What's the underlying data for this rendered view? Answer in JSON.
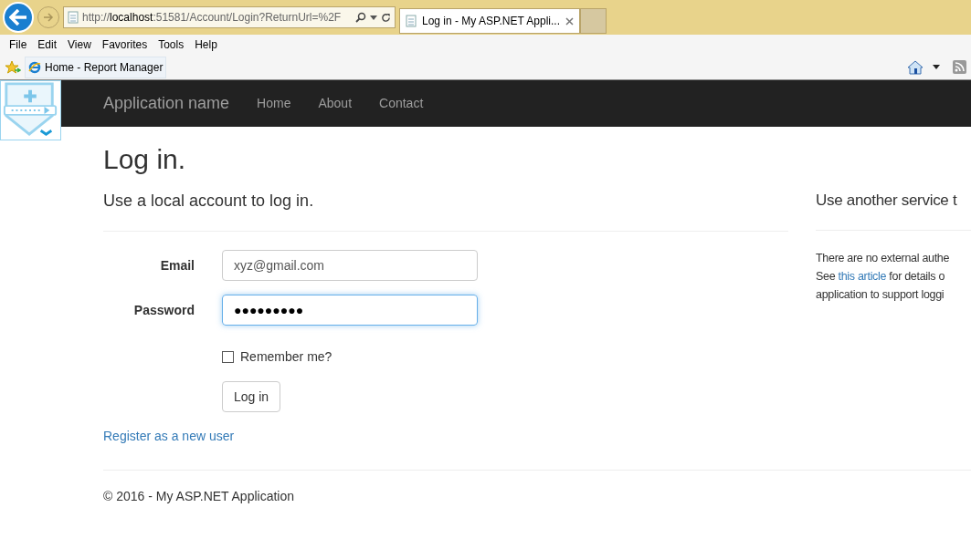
{
  "browser": {
    "address": {
      "prefix": "http://",
      "host": "localhost",
      "rest": ":51581/Account/Login?ReturnUrl=%2F"
    },
    "tabs": [
      {
        "kind": "page",
        "title": "Log in - My ASP.NET Appli...",
        "selected": true
      },
      {
        "kind": "new",
        "selected": false
      }
    ],
    "menu": [
      "File",
      "Edit",
      "View",
      "Favorites",
      "Tools",
      "Help"
    ],
    "favorites": [
      {
        "label": "Home - Report Manager"
      }
    ]
  },
  "navbar": {
    "brand": "Application name",
    "links": [
      "Home",
      "About",
      "Contact"
    ]
  },
  "page": {
    "title": "Log in.",
    "local": {
      "heading": "Use a local account to log in.",
      "fields": [
        {
          "label": "Email",
          "value": "xyz@gmail.com",
          "focused": false
        },
        {
          "label": "Password",
          "value": "●●●●●●●●●",
          "focused": true
        }
      ],
      "remember": {
        "label": "Remember me?",
        "checked": false
      },
      "submit": "Log in",
      "register": "Register as a new user"
    },
    "external": {
      "heading": "Use another service t",
      "line_1": "There are no external authe",
      "see": "See ",
      "link": "this article",
      "line_2_rest": " for details o",
      "line_3": "application to support loggi"
    }
  },
  "footer": "© 2016 - My ASP.NET Application"
}
